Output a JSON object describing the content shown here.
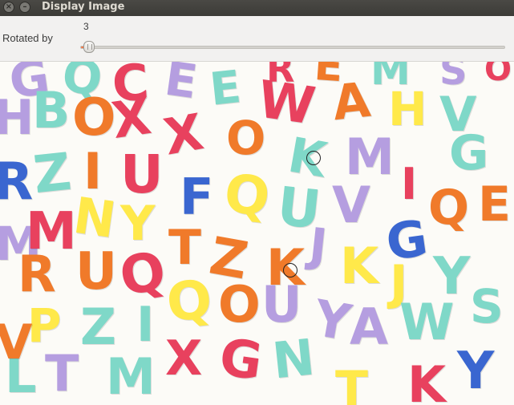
{
  "window": {
    "title": "Display Image",
    "close_glyph": "×",
    "min_glyph": "–"
  },
  "controls": {
    "slider_label": "Rotated by",
    "slider_value": "3"
  },
  "image": {
    "letters": [
      {
        "ch": "G",
        "color": "#b59ee0"
      },
      {
        "ch": "Q",
        "color": "#7fd8c8"
      },
      {
        "ch": "C",
        "color": "#e8415e"
      },
      {
        "ch": "E",
        "color": "#b59ee0"
      },
      {
        "ch": "E",
        "color": "#7fd8c8"
      },
      {
        "ch": "R",
        "color": "#e8415e"
      },
      {
        "ch": "E",
        "color": "#f07a2a"
      },
      {
        "ch": "M",
        "color": "#7fd8c8"
      },
      {
        "ch": "S",
        "color": "#b59ee0"
      },
      {
        "ch": "O",
        "color": "#e8415e"
      },
      {
        "ch": "H",
        "color": "#b59ee0"
      },
      {
        "ch": "B",
        "color": "#7fd8c8"
      },
      {
        "ch": "O",
        "color": "#f07a2a"
      },
      {
        "ch": "X",
        "color": "#e8415e"
      },
      {
        "ch": "X",
        "color": "#e8415e"
      },
      {
        "ch": "O",
        "color": "#f07a2a"
      },
      {
        "ch": "W",
        "color": "#e8415e"
      },
      {
        "ch": "A",
        "color": "#f07a2a"
      },
      {
        "ch": "H",
        "color": "#ffe94a"
      },
      {
        "ch": "V",
        "color": "#7fd8c8"
      },
      {
        "ch": "R",
        "color": "#3a66d0"
      },
      {
        "ch": "Z",
        "color": "#7fd8c8"
      },
      {
        "ch": "I",
        "color": "#f07a2a"
      },
      {
        "ch": "U",
        "color": "#e8415e"
      },
      {
        "ch": "F",
        "color": "#3a66d0"
      },
      {
        "ch": "Q",
        "color": "#ffe94a"
      },
      {
        "ch": "K",
        "color": "#7fd8c8"
      },
      {
        "ch": "M",
        "color": "#b59ee0"
      },
      {
        "ch": "I",
        "color": "#e8415e"
      },
      {
        "ch": "G",
        "color": "#7fd8c8"
      },
      {
        "ch": "M",
        "color": "#b59ee0"
      },
      {
        "ch": "M",
        "color": "#e8415e"
      },
      {
        "ch": "N",
        "color": "#ffe94a"
      },
      {
        "ch": "Y",
        "color": "#ffe94a"
      },
      {
        "ch": "U",
        "color": "#7fd8c8"
      },
      {
        "ch": "V",
        "color": "#b59ee0"
      },
      {
        "ch": "G",
        "color": "#3a66d0"
      },
      {
        "ch": "Q",
        "color": "#f07a2a"
      },
      {
        "ch": "E",
        "color": "#f07a2a"
      },
      {
        "ch": "R",
        "color": "#f07a2a"
      },
      {
        "ch": "U",
        "color": "#f07a2a"
      },
      {
        "ch": "Q",
        "color": "#e8415e"
      },
      {
        "ch": "T",
        "color": "#f07a2a"
      },
      {
        "ch": "Z",
        "color": "#f07a2a"
      },
      {
        "ch": "K",
        "color": "#f07a2a"
      },
      {
        "ch": "J",
        "color": "#b59ee0"
      },
      {
        "ch": "K",
        "color": "#ffe94a"
      },
      {
        "ch": "J",
        "color": "#ffe94a"
      },
      {
        "ch": "Y",
        "color": "#7fd8c8"
      },
      {
        "ch": "P",
        "color": "#ffe94a"
      },
      {
        "ch": "Z",
        "color": "#7fd8c8"
      },
      {
        "ch": "I",
        "color": "#7fd8c8"
      },
      {
        "ch": "Q",
        "color": "#ffe94a"
      },
      {
        "ch": "O",
        "color": "#f07a2a"
      },
      {
        "ch": "U",
        "color": "#b59ee0"
      },
      {
        "ch": "Y",
        "color": "#b59ee0"
      },
      {
        "ch": "A",
        "color": "#b59ee0"
      },
      {
        "ch": "W",
        "color": "#7fd8c8"
      },
      {
        "ch": "S",
        "color": "#7fd8c8"
      },
      {
        "ch": "L",
        "color": "#7fd8c8"
      },
      {
        "ch": "T",
        "color": "#b59ee0"
      },
      {
        "ch": "M",
        "color": "#7fd8c8"
      },
      {
        "ch": "X",
        "color": "#e8415e"
      },
      {
        "ch": "G",
        "color": "#e8415e"
      },
      {
        "ch": "N",
        "color": "#7fd8c8"
      },
      {
        "ch": "T",
        "color": "#ffe94a"
      },
      {
        "ch": "K",
        "color": "#e8415e"
      },
      {
        "ch": "Y",
        "color": "#3a66d0"
      },
      {
        "ch": "V",
        "color": "#f07a2a"
      }
    ]
  }
}
